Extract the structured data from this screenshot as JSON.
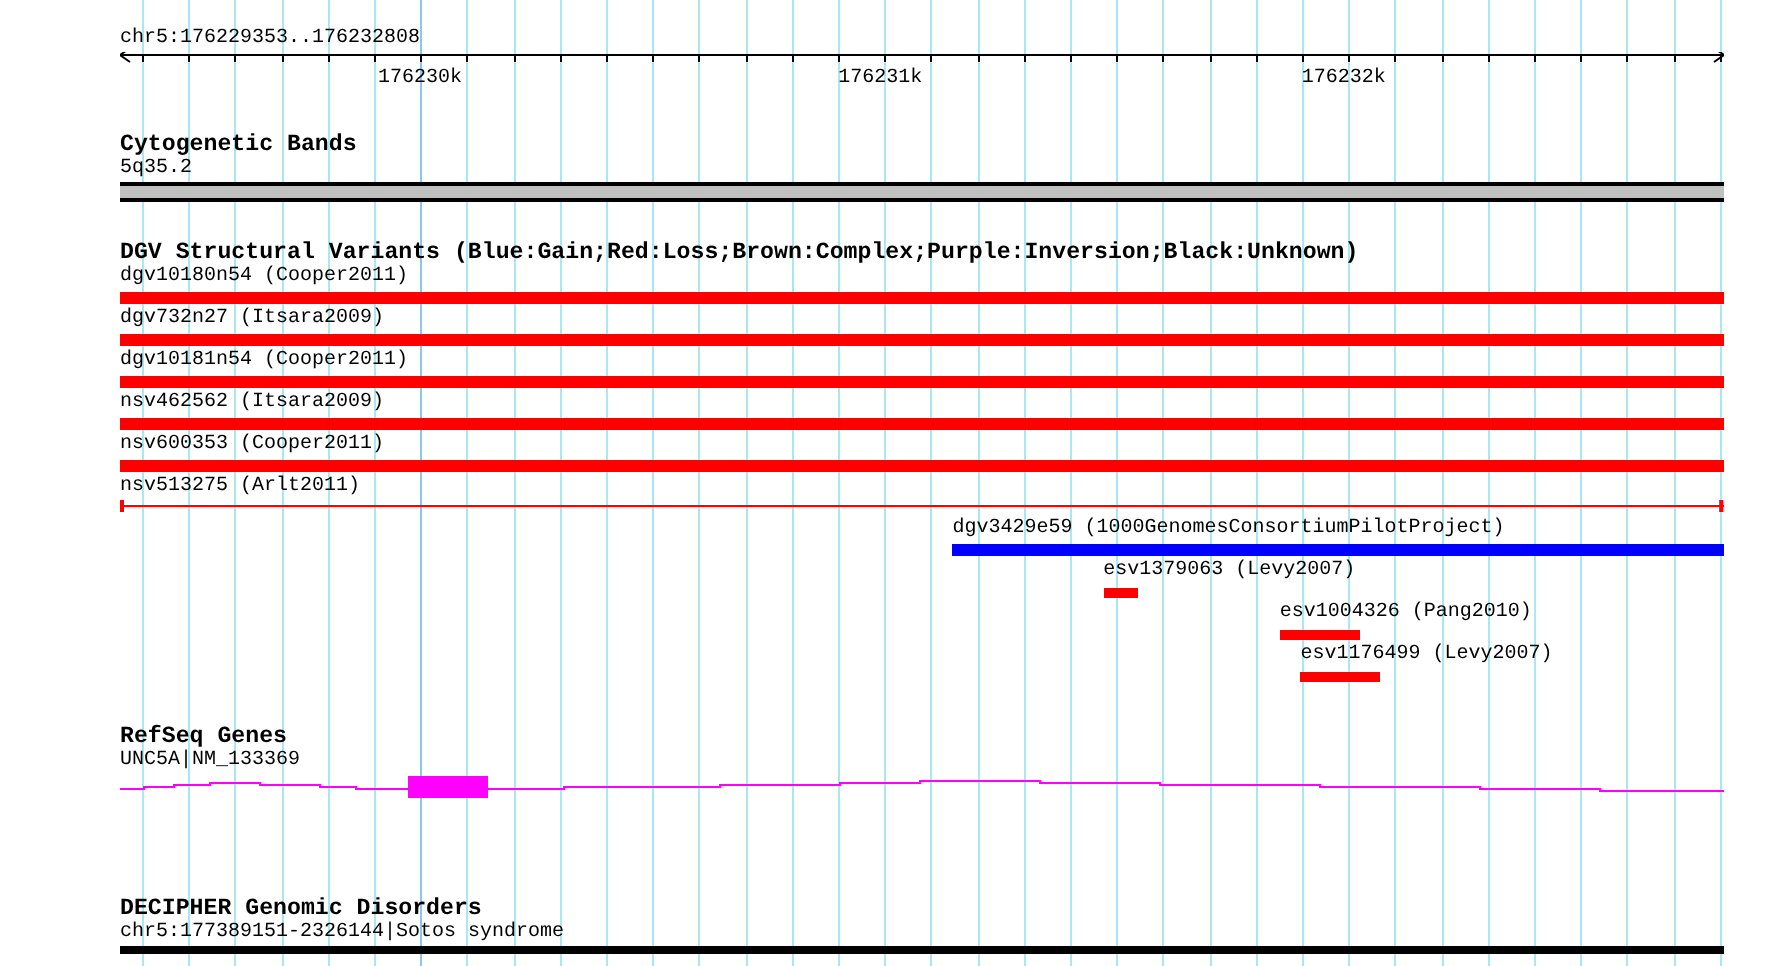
{
  "ruler": {
    "label": "chr5:176229353..176232808",
    "ticks": [
      "176230k",
      "176231k",
      "176232k"
    ]
  },
  "tracks": [
    {
      "kind": "cytoband",
      "title": "Cytogenetic Bands",
      "features": [
        {
          "label": "5q35.2"
        }
      ]
    },
    {
      "kind": "variants",
      "title": "DGV Structural Variants (Blue:Gain;Red:Loss;Brown:Complex;Purple:Inversion;Black:Unknown)",
      "features": [
        {
          "label": "dgv10180n54 (Cooper2011)",
          "kind": "thick",
          "color": "#ff0000"
        },
        {
          "label": "dgv732n27 (Itsara2009)",
          "kind": "thick",
          "color": "#ff0000"
        },
        {
          "label": "dgv10181n54 (Cooper2011)",
          "kind": "thick",
          "color": "#ff0000"
        },
        {
          "label": "nsv462562 (Itsara2009)",
          "kind": "thick",
          "color": "#ff0000"
        },
        {
          "label": "nsv600353 (Cooper2011)",
          "kind": "thick",
          "color": "#ff0000"
        },
        {
          "label": "nsv513275 (Arlt2011)",
          "kind": "thin",
          "color": "#ff0000"
        },
        {
          "label": "dgv3429e59 (1000GenomesConsortiumPilotProject)",
          "kind": "thick",
          "color": "#0000ff"
        },
        {
          "label": "esv1379063 (Levy2007)",
          "kind": "thick",
          "color": "#ff0000"
        },
        {
          "label": "esv1004326 (Pang2010)",
          "kind": "thick",
          "color": "#ff0000"
        },
        {
          "label": "esv1176499 (Levy2007)",
          "kind": "thick",
          "color": "#ff0000"
        }
      ]
    },
    {
      "kind": "gene",
      "title": "RefSeq Genes",
      "features": [
        {
          "label": "UNC5A|NM_133369"
        }
      ]
    },
    {
      "kind": "disorder",
      "title": "DECIPHER Genomic Disorders",
      "features": [
        {
          "label": "chr5:177389151-2326144|Sotos syndrome"
        }
      ]
    }
  ]
}
